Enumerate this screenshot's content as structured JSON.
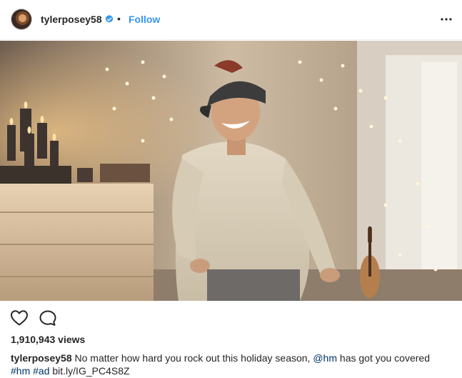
{
  "header": {
    "username": "tylerposey58",
    "separator": "•",
    "follow_label": "Follow"
  },
  "icons": {
    "avatar": "profile-avatar",
    "verified": "verified-badge-icon",
    "more": "more-options-icon",
    "like": "heart-icon",
    "comment": "comment-bubble-icon"
  },
  "colors": {
    "accent": "#3897f0",
    "link": "#003569",
    "text": "#262626",
    "divider": "#efefef"
  },
  "stats": {
    "views": "1,910,943 views"
  },
  "caption": {
    "username": "tylerposey58",
    "text_1": " No matter how hard you rock out this holiday season, ",
    "mention": "@hm",
    "text_2": " has got you covered",
    "tag_1": "#hm",
    "tag_2": "#ad",
    "link": "bit.ly/IG_PC4S8Z"
  }
}
